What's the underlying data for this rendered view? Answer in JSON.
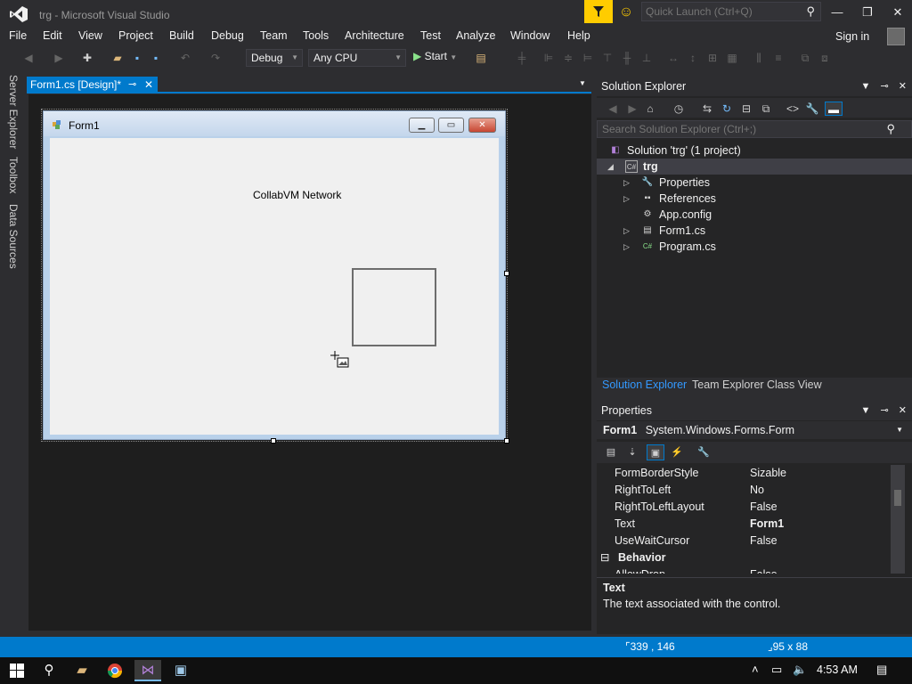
{
  "window": {
    "title": "trg - Microsoft Visual Studio",
    "quick_launch_placeholder": "Quick Launch (Ctrl+Q)"
  },
  "menu": [
    "File",
    "Edit",
    "View",
    "Project",
    "Build",
    "Debug",
    "Team",
    "Tools",
    "Architecture",
    "Test",
    "Analyze",
    "Window",
    "Help"
  ],
  "signin_label": "Sign in",
  "toolbar": {
    "configuration": "Debug",
    "platform": "Any CPU",
    "start_label": "Start"
  },
  "left_tabs": [
    "Server Explorer",
    "Toolbox",
    "Data Sources"
  ],
  "document_tab": {
    "label": "Form1.cs [Design]*"
  },
  "designer": {
    "form_title": "Form1",
    "label_text": "CollabVM Network"
  },
  "solution_explorer": {
    "title": "Solution Explorer",
    "search_placeholder": "Search Solution Explorer (Ctrl+;)",
    "tree": [
      {
        "label": "Solution 'trg' (1 project)",
        "icon": "solution-icon"
      },
      {
        "label": "trg",
        "icon": "csharp-project-icon"
      },
      {
        "label": "Properties",
        "icon": "wrench-icon"
      },
      {
        "label": "References",
        "icon": "references-icon"
      },
      {
        "label": "App.config",
        "icon": "config-icon"
      },
      {
        "label": "Form1.cs",
        "icon": "form-icon"
      },
      {
        "label": "Program.cs",
        "icon": "csharp-file-icon"
      }
    ],
    "tabs": [
      "Solution Explorer",
      "Team Explorer",
      "Class View"
    ]
  },
  "properties": {
    "title": "Properties",
    "object_name": "Form1",
    "object_type": "System.Windows.Forms.Form",
    "rows": [
      {
        "name": "FormBorderStyle",
        "value": "Sizable"
      },
      {
        "name": "RightToLeft",
        "value": "No"
      },
      {
        "name": "RightToLeftLayout",
        "value": "False"
      },
      {
        "name": "Text",
        "value": "Form1"
      },
      {
        "name": "UseWaitCursor",
        "value": "False"
      }
    ],
    "category": "Behavior",
    "partial_row": {
      "name": "AllowDrop",
      "value": "False"
    },
    "description_title": "Text",
    "description_text": "The text associated with the control."
  },
  "statusbar": {
    "position": "339 , 146",
    "size": "95 x 88"
  },
  "taskbar": {
    "clock": "4:53 AM"
  },
  "colors": {
    "accent": "#007acc",
    "feedback": "#ffcc00",
    "background": "#2d2d30"
  }
}
